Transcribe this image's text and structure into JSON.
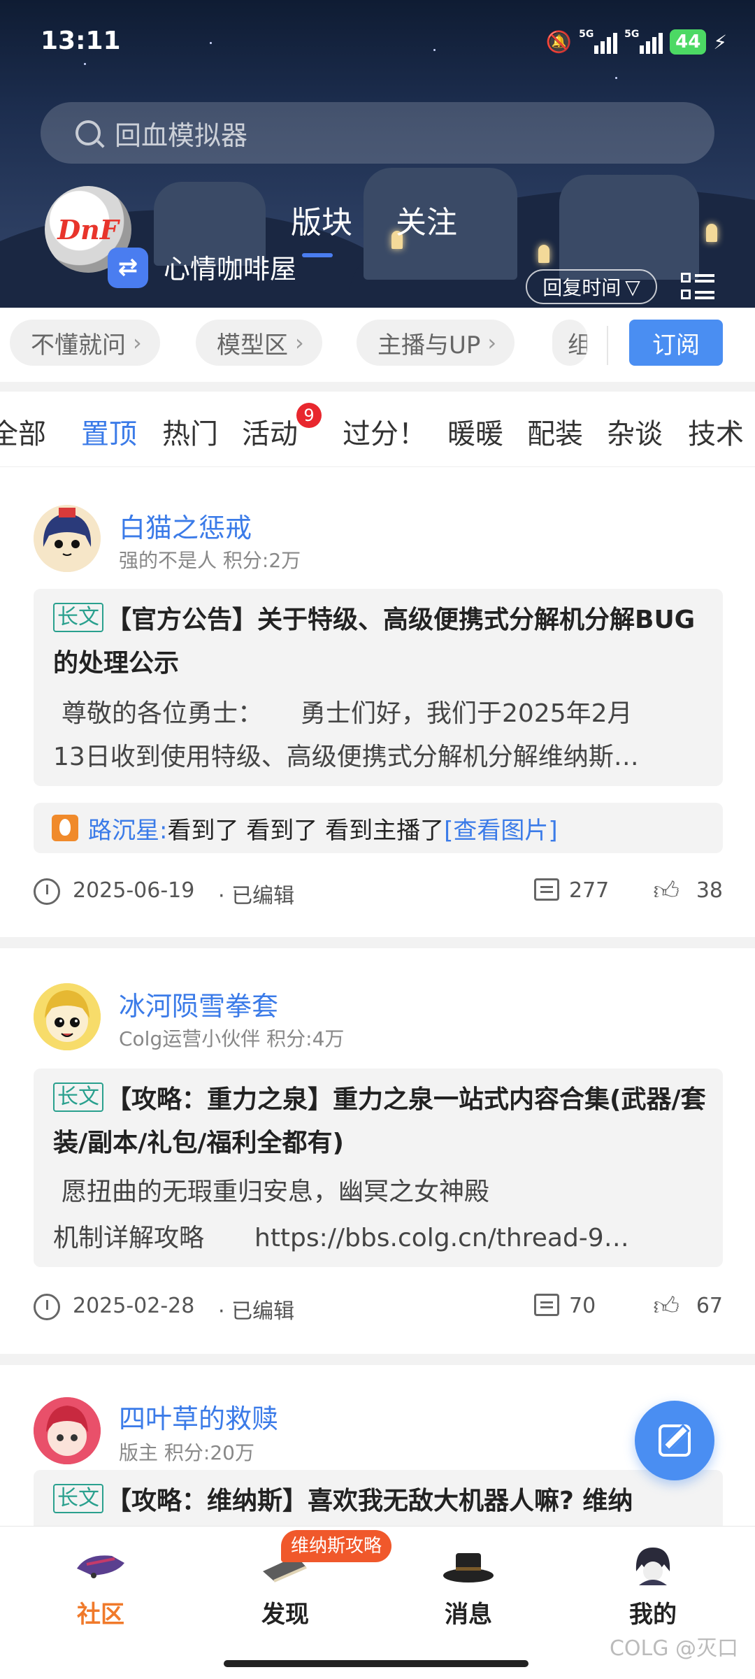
{
  "status_bar": {
    "time": "13:11",
    "network_1": "5G",
    "network_2": "5G",
    "battery": "44"
  },
  "search": {
    "placeholder": "回血模拟器"
  },
  "header": {
    "tabs": [
      "版块",
      "关注"
    ],
    "board_name": "心情咖啡屋",
    "logo_text": "DnF",
    "sort_label": "回复时间",
    "switch_icon": "swap-icon"
  },
  "quick_chips": [
    "不懂就问",
    "模型区",
    "主播与UP",
    "组"
  ],
  "subscribe_label": "订阅",
  "categories": [
    {
      "label": "全部",
      "active": false
    },
    {
      "label": "置顶",
      "active": true
    },
    {
      "label": "热门",
      "active": false
    },
    {
      "label": "活动",
      "active": false
    },
    {
      "label": "过分！",
      "active": false
    },
    {
      "label": "暖暖",
      "active": false
    },
    {
      "label": "配装",
      "active": false
    },
    {
      "label": "杂谈",
      "active": false
    },
    {
      "label": "技术",
      "active": false
    }
  ],
  "activity_badge": "9",
  "posts": [
    {
      "author": "白猫之惩戒",
      "meta": "强的不是人  积分:2万",
      "tag": "长文",
      "title": "【官方公告】关于特级、高级便携式分解机分解BUG的处理公示",
      "excerpt_1": "尊敬的各位勇士：　　勇士们好，我们于2025年2月",
      "excerpt_2": "13日收到使用特级、高级便携式分解机分解维纳斯…",
      "reply_user": "路沉星:",
      "reply_text": "看到了 看到了 看到主播了",
      "reply_link": "[查看图片]",
      "date": "2025-06-19",
      "edited": "· 已编辑",
      "comments": "277",
      "likes": "38"
    },
    {
      "author": "冰河陨雪拳套",
      "meta": "Colg运营小伙伴  积分:4万",
      "tag": "长文",
      "title": "【攻略：重力之泉】重力之泉一站式内容合集(武器/套装/副本/礼包/福利全都有)",
      "excerpt_1": "愿扭曲的无瑕重归安息，幽冥之女神殿",
      "excerpt_2": "机制详解攻略　　https://bbs.colg.cn/thread-9…",
      "date": "2025-02-28",
      "edited": "· 已编辑",
      "comments": "70",
      "likes": "67"
    },
    {
      "author": "四叶草的救赎",
      "meta": "版主  积分:20万",
      "tag": "长文",
      "title": "【攻略：维纳斯】喜欢我无敌大机器人嘛? 维纳"
    }
  ],
  "bottom_nav": [
    {
      "label": "社区",
      "active": true
    },
    {
      "label": "发现",
      "active": false
    },
    {
      "label": "消息",
      "active": false
    },
    {
      "label": "我的",
      "active": false
    }
  ],
  "discover_badge": "维纳斯攻略",
  "watermark": "COLG @灭口",
  "colors": {
    "accent": "#3b7be8",
    "active_nav": "#f07a2b",
    "tag": "#2aa08e",
    "badge": "#e8272e"
  }
}
